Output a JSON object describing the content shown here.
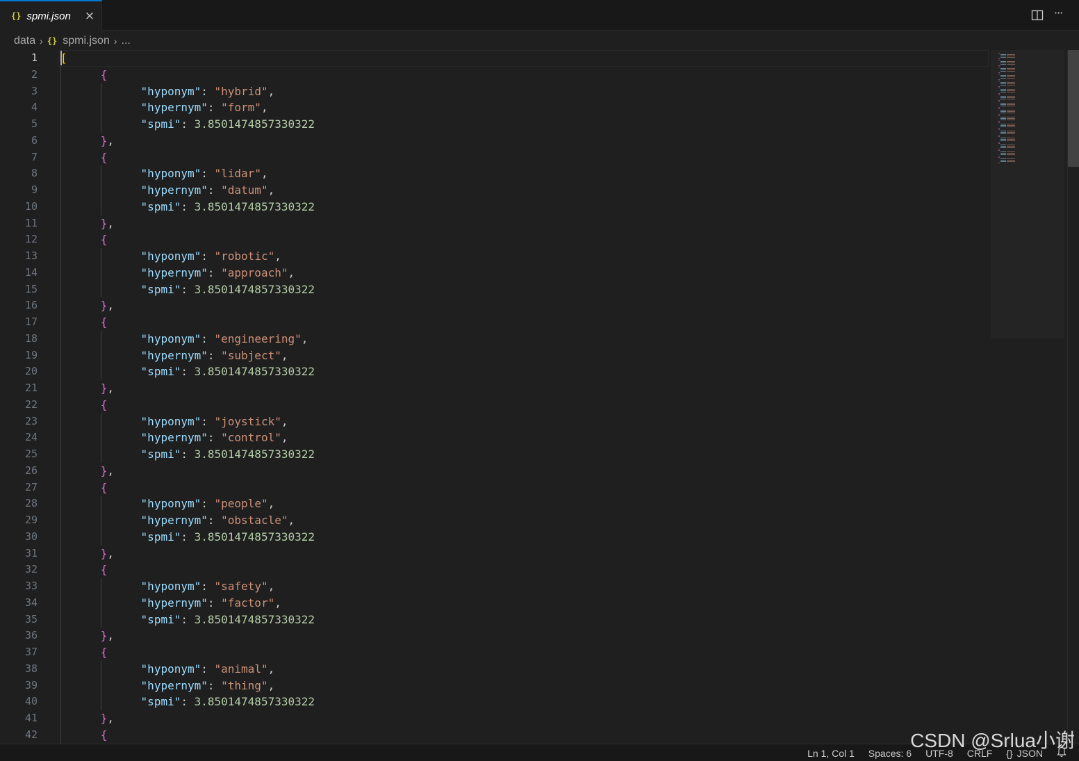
{
  "tab": {
    "icon": "{}",
    "label": "spmi.json",
    "close_glyph": "×"
  },
  "tab_actions": [
    {
      "name": "split-editor-icon"
    },
    {
      "name": "more-actions-icon",
      "glyph": "···"
    }
  ],
  "breadcrumb": {
    "items": [
      "data",
      "spmi.json",
      "..."
    ],
    "file_icon": "{}",
    "sep": "›"
  },
  "editor": {
    "line_numbers": [
      "1",
      "2",
      "3",
      "4",
      "5",
      "6",
      "7",
      "8",
      "9",
      "10",
      "11",
      "12",
      "13",
      "14",
      "15",
      "16",
      "17",
      "18",
      "19",
      "20",
      "21",
      "22",
      "23",
      "24",
      "25",
      "26",
      "27",
      "28",
      "29",
      "30",
      "31",
      "32",
      "33",
      "34",
      "35",
      "36",
      "37",
      "38",
      "39",
      "40",
      "41",
      "42"
    ],
    "active_line": 1,
    "entries": [
      {
        "hyponym": "hybrid",
        "hypernym": "form",
        "spmi": "3.8501474857330322"
      },
      {
        "hyponym": "lidar",
        "hypernym": "datum",
        "spmi": "3.8501474857330322"
      },
      {
        "hyponym": "robotic",
        "hypernym": "approach",
        "spmi": "3.8501474857330322"
      },
      {
        "hyponym": "engineering",
        "hypernym": "subject",
        "spmi": "3.8501474857330322"
      },
      {
        "hyponym": "joystick",
        "hypernym": "control",
        "spmi": "3.8501474857330322"
      },
      {
        "hyponym": "people",
        "hypernym": "obstacle",
        "spmi": "3.8501474857330322"
      },
      {
        "hyponym": "safety",
        "hypernym": "factor",
        "spmi": "3.8501474857330322"
      },
      {
        "hyponym": "animal",
        "hypernym": "thing",
        "spmi": "3.8501474857330322"
      }
    ],
    "keys": {
      "hyponym": "hyponym",
      "hypernym": "hypernym",
      "spmi": "spmi"
    },
    "colors": {
      "bracket0": "#ffd700",
      "bracket1": "#da70d6",
      "key": "#9cdcfe",
      "string": "#ce9178",
      "number": "#b5cea8"
    }
  },
  "status": {
    "position": "Ln 1, Col 1",
    "spaces": "Spaces: 6",
    "encoding": "UTF-8",
    "eol": "CRLF",
    "language_icon": "{}",
    "language": "JSON"
  },
  "watermark": "CSDN @Srlua小谢"
}
